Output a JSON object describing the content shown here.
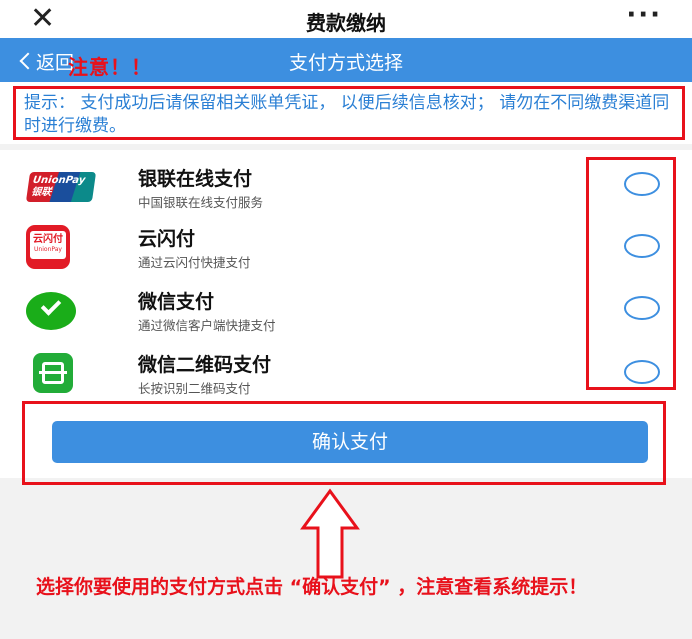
{
  "titlebar": {
    "title": "费款缴纳",
    "close_icon": "close-icon",
    "more_icon": "more-icon"
  },
  "navbar": {
    "back_label": "返回",
    "title": "支付方式选择"
  },
  "annotation": {
    "attention": "注意！！",
    "instruction": "选择你要使用的支付方式点击 “确认支付” ，注意查看系统提示！"
  },
  "notice": {
    "text": "提示：  支付成功后请保留相关账单凭证，  以便后续信息核对；  请勿在不同缴费渠道同时进行缴费。"
  },
  "payment_methods": [
    {
      "name": "银联在线支付",
      "desc": "中国银联在线支付服务",
      "icon": "unionpay-icon",
      "icon_text": "UnionPay 银联",
      "selected": false
    },
    {
      "name": "云闪付",
      "desc": "通过云闪付快捷支付",
      "icon": "yunshanfu-icon",
      "icon_text": "云闪付",
      "icon_subtext": "UnionPay",
      "selected": false
    },
    {
      "name": "微信支付",
      "desc": "通过微信客户端快捷支付",
      "icon": "wechat-pay-icon",
      "selected": false
    },
    {
      "name": "微信二维码支付",
      "desc": "长按识别二维码支付",
      "icon": "wechat-qr-icon",
      "selected": false
    }
  ],
  "confirm": {
    "label": "确认支付"
  },
  "colors": {
    "accent": "#3d8fe0",
    "annotation_red": "#e8111b",
    "notice_blue": "#2a7fd4"
  }
}
